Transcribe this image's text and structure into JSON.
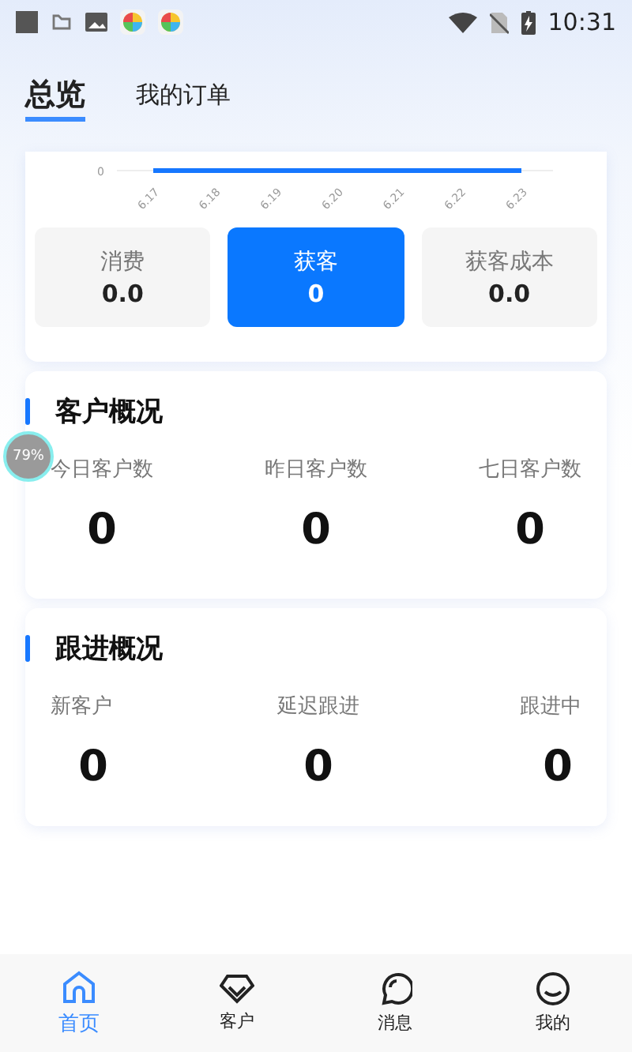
{
  "status_bar": {
    "time": "10:31"
  },
  "tabs": [
    {
      "label": "总览",
      "selected": true
    },
    {
      "label": "我的订单",
      "selected": false
    }
  ],
  "trend_card": {
    "zero_label": "0",
    "date_labels": [
      "6.17",
      "6.18",
      "6.19",
      "6.20",
      "6.21",
      "6.22",
      "6.23"
    ],
    "metrics": [
      {
        "label": "消费",
        "value": "0.0",
        "selected": false
      },
      {
        "label": "获客",
        "value": "0",
        "selected": true
      },
      {
        "label": "获客成本",
        "value": "0.0",
        "selected": false
      }
    ]
  },
  "sections": [
    {
      "title": "客户概况",
      "stats": [
        {
          "label": "今日客户数",
          "value": "0"
        },
        {
          "label": "昨日客户数",
          "value": "0"
        },
        {
          "label": "七日客户数",
          "value": "0"
        }
      ]
    },
    {
      "title": "跟进概况",
      "stats": [
        {
          "label": "新客户",
          "value": "0"
        },
        {
          "label": "延迟跟进",
          "value": "0"
        },
        {
          "label": "跟进中",
          "value": "0"
        }
      ]
    }
  ],
  "floating_badge": {
    "text": "79%"
  },
  "bottom_nav": [
    {
      "label": "首页",
      "kind": "home",
      "selected": true
    },
    {
      "label": "客户",
      "kind": "gem",
      "selected": false
    },
    {
      "label": "消息",
      "kind": "chat",
      "selected": false
    },
    {
      "label": "我的",
      "kind": "face",
      "selected": false
    }
  ]
}
